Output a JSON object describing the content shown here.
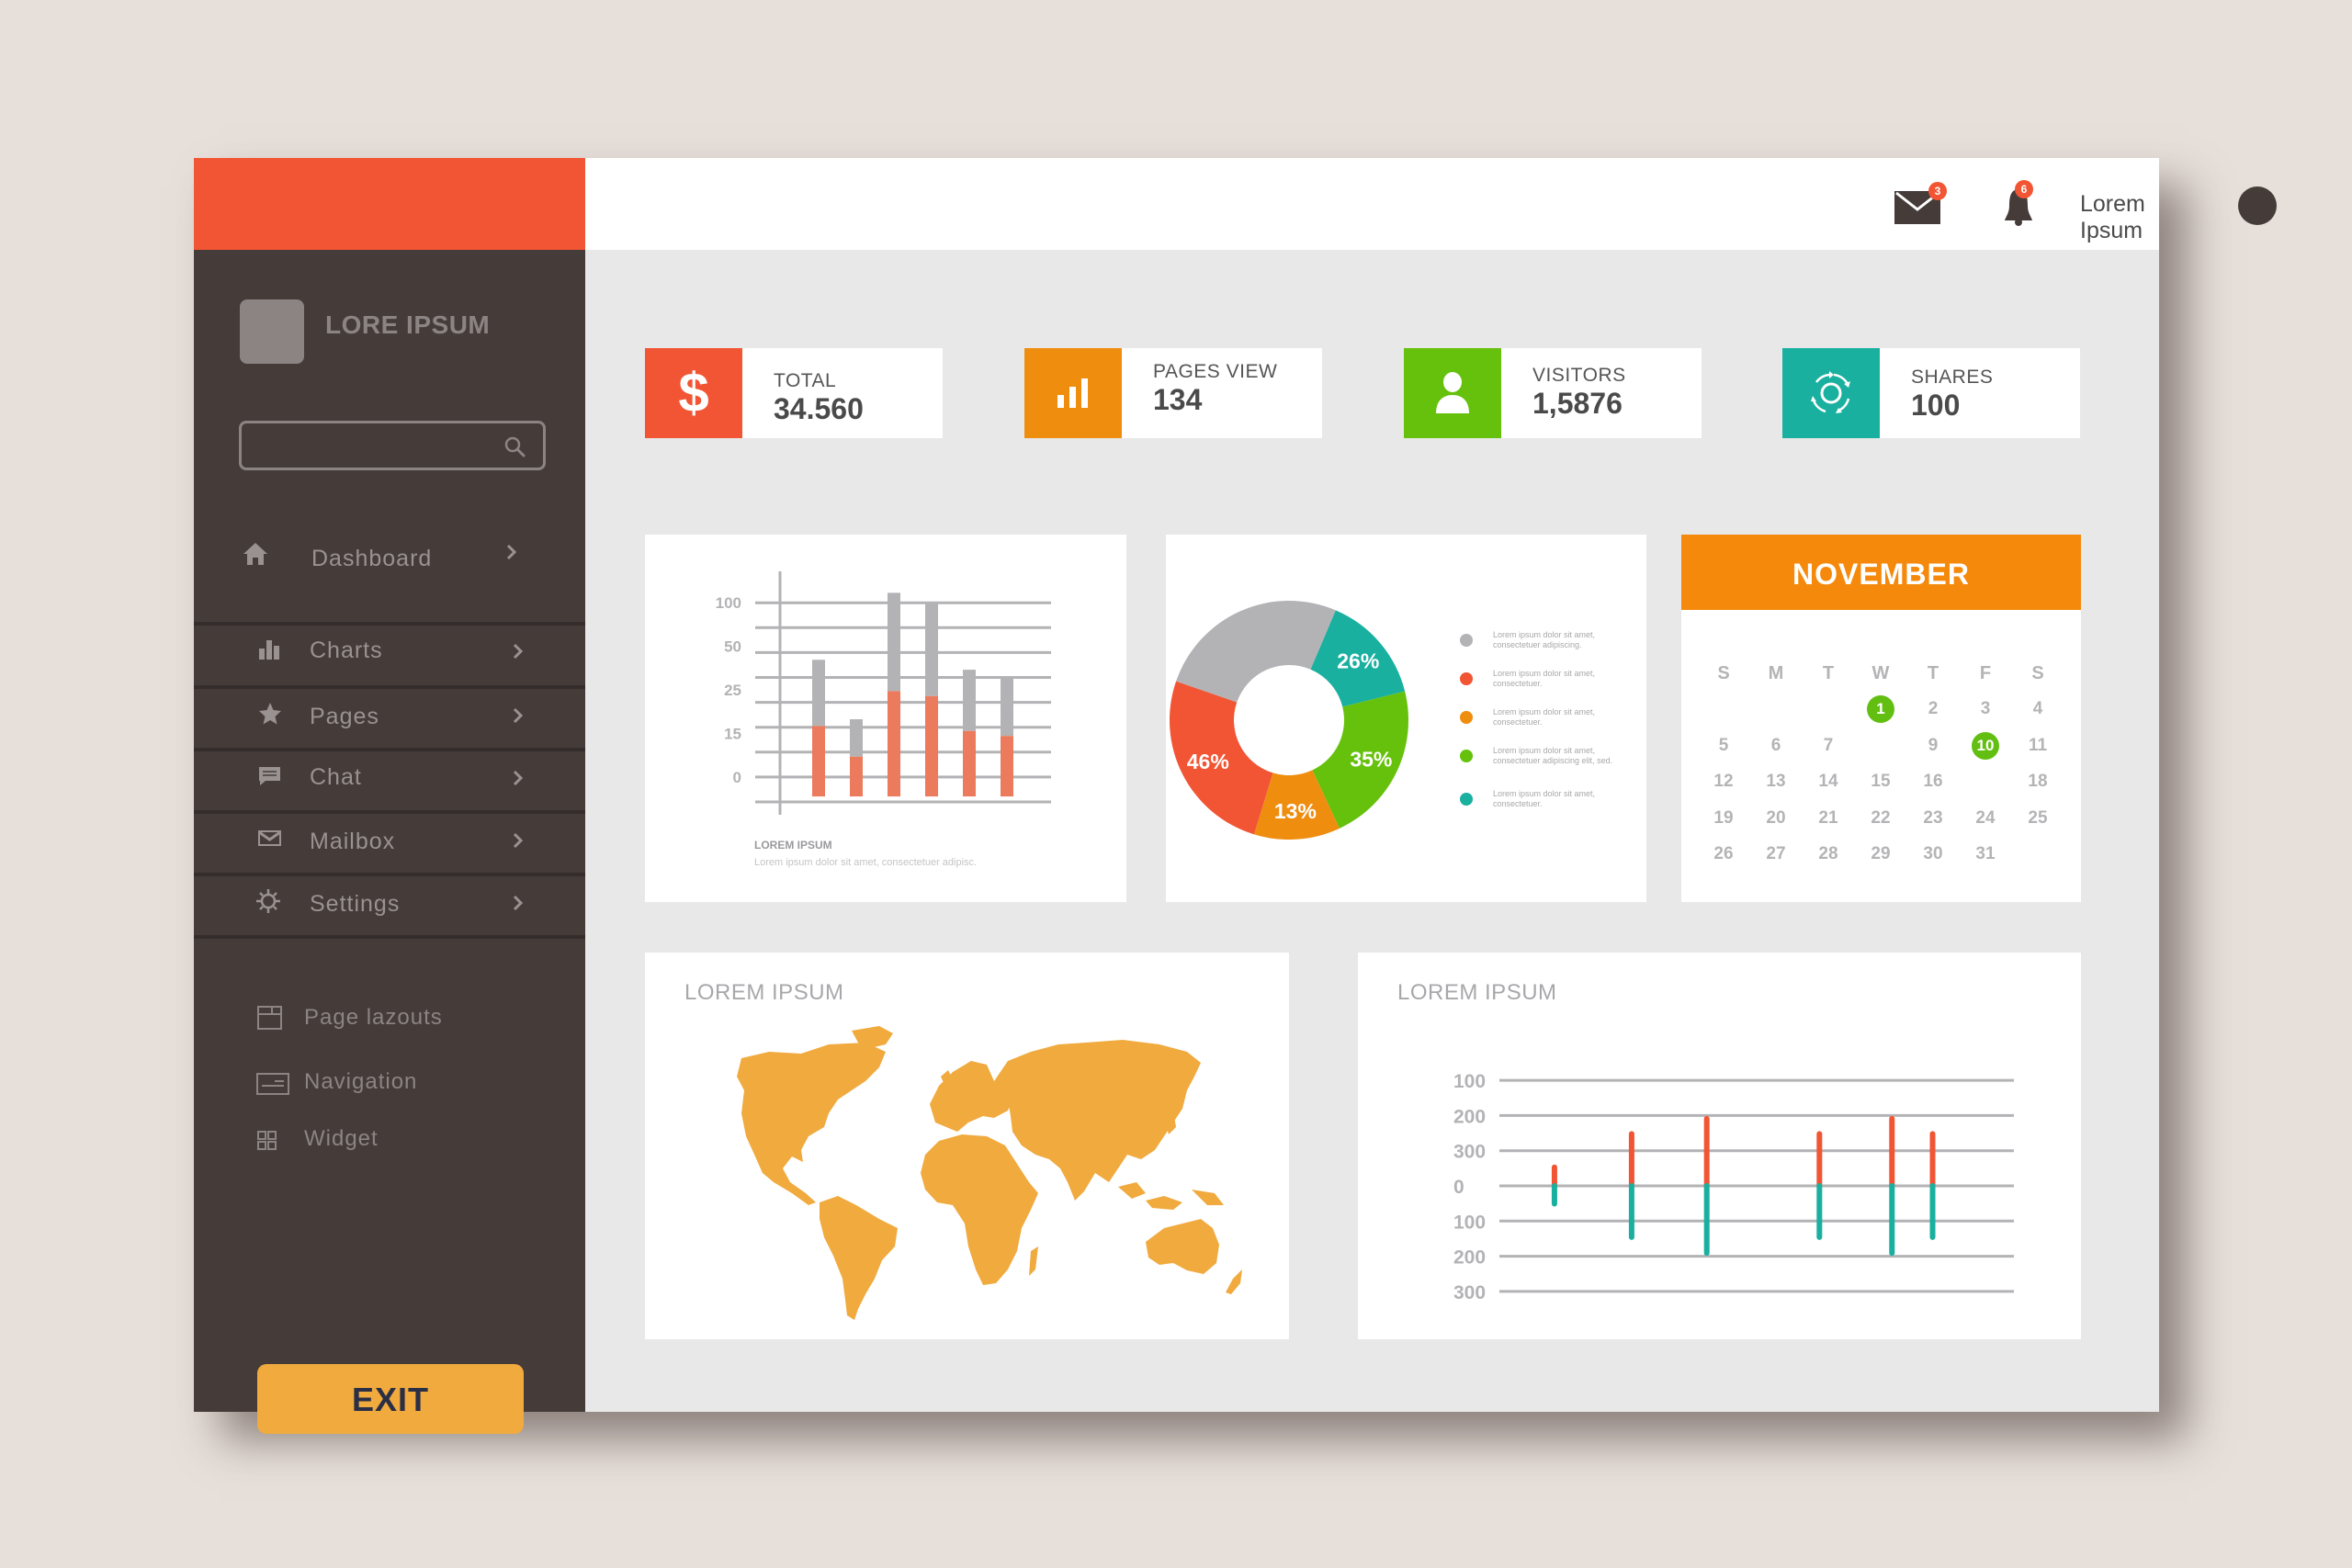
{
  "sidebar": {
    "brand": "LORE IPSUM",
    "search": {
      "value": "",
      "placeholder": ""
    },
    "nav": [
      {
        "label": "Dashboard",
        "icon": "home-icon"
      },
      {
        "label": "Charts",
        "icon": "bar-chart-icon"
      },
      {
        "label": "Pages",
        "icon": "star-icon"
      },
      {
        "label": "Chat",
        "icon": "chat-icon"
      },
      {
        "label": "Mailbox",
        "icon": "mail-icon"
      },
      {
        "label": "Settings",
        "icon": "gear-icon"
      }
    ],
    "secondary": [
      {
        "label": "Page lazouts",
        "icon": "layout-icon"
      },
      {
        "label": "Navigation",
        "icon": "navigation-icon"
      },
      {
        "label": "Widget",
        "icon": "widget-grid-icon"
      }
    ],
    "exit_label": "EXIT"
  },
  "header": {
    "mail_badge": "3",
    "bell_badge": "6",
    "user_name": "Lorem Ipsum"
  },
  "stats": [
    {
      "label": "TOTAL",
      "value": "34.560",
      "icon": "dollar-icon",
      "color": "#f15533"
    },
    {
      "label": "PAGES VIEW",
      "value": "134",
      "icon": "bar-chart-icon",
      "color": "#ef8d0f"
    },
    {
      "label": "VISITORS",
      "value": "1,5876",
      "icon": "user-icon",
      "color": "#66c10c"
    },
    {
      "label": "SHARES",
      "value": "100",
      "icon": "share-cycle-icon",
      "color": "#19b0a0"
    }
  ],
  "colors": {
    "accent_red": "#f15533",
    "accent_orange": "#f5890c",
    "accent_green": "#66c10c",
    "accent_teal": "#19b0a0",
    "sidebar_bg": "#453c3a",
    "map_fill": "#f0aa3e",
    "gray_bar": "#b3b3b6",
    "salmon_bar": "#ec7a5c"
  },
  "calendar": {
    "month": "NOVEMBER",
    "weekdays": [
      "S",
      "M",
      "T",
      "W",
      "T",
      "F",
      "S"
    ],
    "weeks": [
      [
        "",
        "",
        "",
        "1",
        "2",
        "3",
        "4"
      ],
      [
        "5",
        "6",
        "7",
        "",
        "9",
        "10",
        "11"
      ],
      [
        "12",
        "13",
        "14",
        "15",
        "16",
        "",
        "18"
      ],
      [
        "19",
        "20",
        "21",
        "22",
        "23",
        "24",
        "25"
      ],
      [
        "26",
        "27",
        "28",
        "29",
        "30",
        "31",
        ""
      ]
    ],
    "highlighted": [
      "1",
      "10"
    ]
  },
  "map_card": {
    "title": "LOREM IPSUM"
  },
  "chart_data": [
    {
      "type": "bar",
      "stacked": true,
      "title": "LOREM IPSUM",
      "subtitle": "Lorem ipsum dolor sit amet, consectetuer adipisc.",
      "ytick_labels": [
        "100",
        "50",
        "25",
        "15",
        "0"
      ],
      "gridlines": 9,
      "units": "gridline steps above bottom gridline",
      "base": 0.22,
      "series": [
        {
          "name": "lower",
          "color": "#ec7a5c",
          "values": [
            3.05,
            1.82,
            4.45,
            4.25,
            2.85,
            2.65
          ]
        },
        {
          "name": "upper",
          "color": "#b3b3b6",
          "values": [
            5.71,
            3.32,
            8.4,
            7.96,
            5.31,
            4.95
          ]
        }
      ],
      "grid": true
    },
    {
      "type": "pie",
      "donut": true,
      "slices": [
        {
          "label": "26%",
          "color": "#19b0a0",
          "span_deg": 53
        },
        {
          "label": "35%",
          "color": "#66c10c",
          "span_deg": 79
        },
        {
          "label": "13%",
          "color": "#ef8d0f",
          "span_deg": 42
        },
        {
          "label": "46%",
          "color": "#f15533",
          "span_deg": 92
        },
        {
          "label": "",
          "color": "#b3b3b6",
          "span_deg": 94
        }
      ],
      "start_deg": 23,
      "legend": [
        {
          "color": "#b3b3b6",
          "text": "Lorem ipsum dolor sit amet, consectetuer adipiscing."
        },
        {
          "color": "#f15533",
          "text": "Lorem ipsum dolor sit amet, consectetuer."
        },
        {
          "color": "#ef8d0f",
          "text": "Lorem ipsum dolor sit amet, consectetuer."
        },
        {
          "color": "#66c10c",
          "text": "Lorem ipsum dolor sit amet, consectetuer adipiscing elit, sed."
        },
        {
          "color": "#19b0a0",
          "text": "Lorem ipsum dolor sit amet, consectetuer."
        }
      ],
      "legend_position": "right"
    },
    {
      "type": "bar",
      "diverging": true,
      "title": "LOREM IPSUM",
      "ytick_labels": [
        "100",
        "200",
        "300",
        "0",
        "100",
        "200",
        "300"
      ],
      "x": [
        0.107,
        0.257,
        0.403,
        0.622,
        0.763,
        0.842
      ],
      "series": [
        {
          "name": "positive",
          "color": "#f15533",
          "values": [
            53,
            148,
            191,
            148,
            191,
            148
          ]
        },
        {
          "name": "negative",
          "color": "#19b0a0",
          "values": [
            51,
            146,
            191,
            146,
            191,
            146
          ]
        }
      ],
      "ylim": [
        -300,
        300
      ],
      "grid": true
    }
  ]
}
